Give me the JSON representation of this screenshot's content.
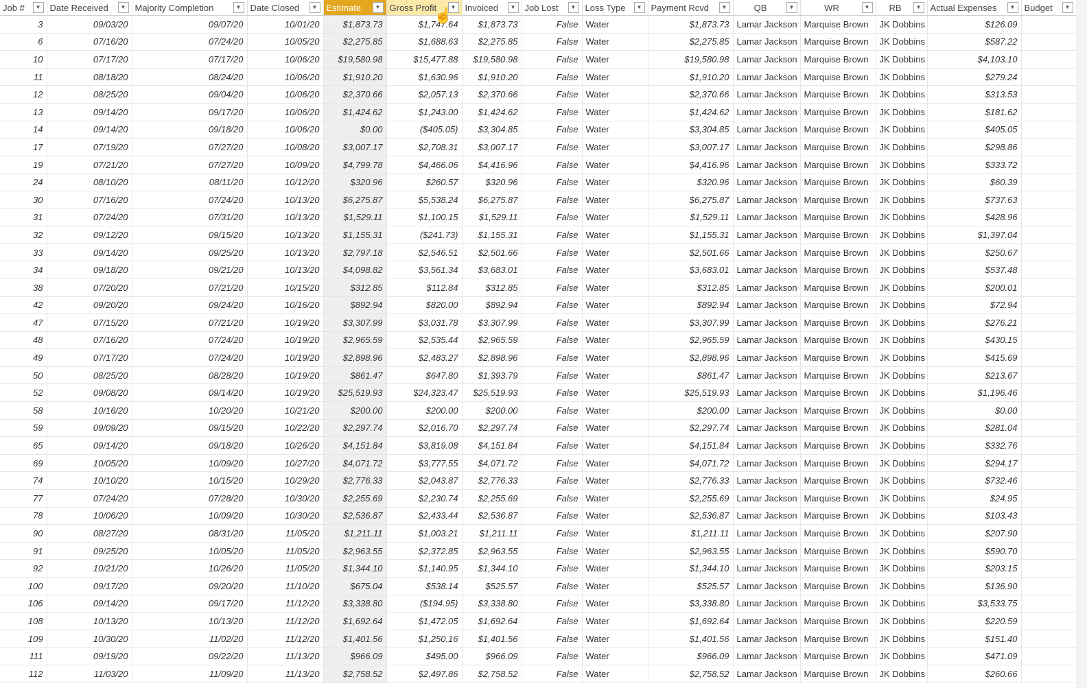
{
  "columns": [
    "Job #",
    "Date Received",
    "Majority Completion",
    "Date Closed",
    "Estimate",
    "Gross Profit",
    "Invoiced",
    "Job Lost",
    "Loss Type",
    "Payment Rcvd",
    "QB",
    "WR",
    "RB",
    "Actual Expenses",
    "Budget"
  ],
  "selected_column": "Estimate",
  "hovered_column": "Gross Profit",
  "colors": {
    "selected_header": "#e3a61f",
    "hover_header": "#fbe9a9",
    "selected_column_bg": "#efefef"
  },
  "rows": [
    [
      "3",
      "09/03/20",
      "09/07/20",
      "10/01/20",
      "$1,873.73",
      "$1,747.64",
      "$1,873.73",
      "False",
      "Water",
      "$1,873.73",
      "Lamar Jackson",
      "Marquise Brown",
      "JK Dobbins",
      "$126.09",
      ""
    ],
    [
      "6",
      "07/16/20",
      "07/24/20",
      "10/05/20",
      "$2,275.85",
      "$1,688.63",
      "$2,275.85",
      "False",
      "Water",
      "$2,275.85",
      "Lamar Jackson",
      "Marquise Brown",
      "JK Dobbins",
      "$587.22",
      ""
    ],
    [
      "10",
      "07/17/20",
      "07/17/20",
      "10/06/20",
      "$19,580.98",
      "$15,477.88",
      "$19,580.98",
      "False",
      "Water",
      "$19,580.98",
      "Lamar Jackson",
      "Marquise Brown",
      "JK Dobbins",
      "$4,103.10",
      ""
    ],
    [
      "11",
      "08/18/20",
      "08/24/20",
      "10/06/20",
      "$1,910.20",
      "$1,630.96",
      "$1,910.20",
      "False",
      "Water",
      "$1,910.20",
      "Lamar Jackson",
      "Marquise Brown",
      "JK Dobbins",
      "$279.24",
      ""
    ],
    [
      "12",
      "08/25/20",
      "09/04/20",
      "10/06/20",
      "$2,370.66",
      "$2,057.13",
      "$2,370.66",
      "False",
      "Water",
      "$2,370.66",
      "Lamar Jackson",
      "Marquise Brown",
      "JK Dobbins",
      "$313.53",
      ""
    ],
    [
      "13",
      "09/14/20",
      "09/17/20",
      "10/06/20",
      "$1,424.62",
      "$1,243.00",
      "$1,424.62",
      "False",
      "Water",
      "$1,424.62",
      "Lamar Jackson",
      "Marquise Brown",
      "JK Dobbins",
      "$181.62",
      ""
    ],
    [
      "14",
      "09/14/20",
      "09/18/20",
      "10/06/20",
      "$0.00",
      "($405.05)",
      "$3,304.85",
      "False",
      "Water",
      "$3,304.85",
      "Lamar Jackson",
      "Marquise Brown",
      "JK Dobbins",
      "$405.05",
      ""
    ],
    [
      "17",
      "07/19/20",
      "07/27/20",
      "10/08/20",
      "$3,007.17",
      "$2,708.31",
      "$3,007.17",
      "False",
      "Water",
      "$3,007.17",
      "Lamar Jackson",
      "Marquise Brown",
      "JK Dobbins",
      "$298.86",
      ""
    ],
    [
      "19",
      "07/21/20",
      "07/27/20",
      "10/09/20",
      "$4,799.78",
      "$4,466.06",
      "$4,416.96",
      "False",
      "Water",
      "$4,416.96",
      "Lamar Jackson",
      "Marquise Brown",
      "JK Dobbins",
      "$333.72",
      ""
    ],
    [
      "24",
      "08/10/20",
      "08/11/20",
      "10/12/20",
      "$320.96",
      "$260.57",
      "$320.96",
      "False",
      "Water",
      "$320.96",
      "Lamar Jackson",
      "Marquise Brown",
      "JK Dobbins",
      "$60.39",
      ""
    ],
    [
      "30",
      "07/16/20",
      "07/24/20",
      "10/13/20",
      "$6,275.87",
      "$5,538.24",
      "$6,275.87",
      "False",
      "Water",
      "$6,275.87",
      "Lamar Jackson",
      "Marquise Brown",
      "JK Dobbins",
      "$737.63",
      ""
    ],
    [
      "31",
      "07/24/20",
      "07/31/20",
      "10/13/20",
      "$1,529.11",
      "$1,100.15",
      "$1,529.11",
      "False",
      "Water",
      "$1,529.11",
      "Lamar Jackson",
      "Marquise Brown",
      "JK Dobbins",
      "$428.96",
      ""
    ],
    [
      "32",
      "09/12/20",
      "09/15/20",
      "10/13/20",
      "$1,155.31",
      "($241.73)",
      "$1,155.31",
      "False",
      "Water",
      "$1,155.31",
      "Lamar Jackson",
      "Marquise Brown",
      "JK Dobbins",
      "$1,397.04",
      ""
    ],
    [
      "33",
      "09/14/20",
      "09/25/20",
      "10/13/20",
      "$2,797.18",
      "$2,546.51",
      "$2,501.66",
      "False",
      "Water",
      "$2,501.66",
      "Lamar Jackson",
      "Marquise Brown",
      "JK Dobbins",
      "$250.67",
      ""
    ],
    [
      "34",
      "09/18/20",
      "09/21/20",
      "10/13/20",
      "$4,098.82",
      "$3,561.34",
      "$3,683.01",
      "False",
      "Water",
      "$3,683.01",
      "Lamar Jackson",
      "Marquise Brown",
      "JK Dobbins",
      "$537.48",
      ""
    ],
    [
      "38",
      "07/20/20",
      "07/21/20",
      "10/15/20",
      "$312.85",
      "$112.84",
      "$312.85",
      "False",
      "Water",
      "$312.85",
      "Lamar Jackson",
      "Marquise Brown",
      "JK Dobbins",
      "$200.01",
      ""
    ],
    [
      "42",
      "09/20/20",
      "09/24/20",
      "10/16/20",
      "$892.94",
      "$820.00",
      "$892.94",
      "False",
      "Water",
      "$892.94",
      "Lamar Jackson",
      "Marquise Brown",
      "JK Dobbins",
      "$72.94",
      ""
    ],
    [
      "47",
      "07/15/20",
      "07/21/20",
      "10/19/20",
      "$3,307.99",
      "$3,031.78",
      "$3,307.99",
      "False",
      "Water",
      "$3,307.99",
      "Lamar Jackson",
      "Marquise Brown",
      "JK Dobbins",
      "$276.21",
      ""
    ],
    [
      "48",
      "07/16/20",
      "07/24/20",
      "10/19/20",
      "$2,965.59",
      "$2,535.44",
      "$2,965.59",
      "False",
      "Water",
      "$2,965.59",
      "Lamar Jackson",
      "Marquise Brown",
      "JK Dobbins",
      "$430.15",
      ""
    ],
    [
      "49",
      "07/17/20",
      "07/24/20",
      "10/19/20",
      "$2,898.96",
      "$2,483.27",
      "$2,898.96",
      "False",
      "Water",
      "$2,898.96",
      "Lamar Jackson",
      "Marquise Brown",
      "JK Dobbins",
      "$415.69",
      ""
    ],
    [
      "50",
      "08/25/20",
      "08/28/20",
      "10/19/20",
      "$861.47",
      "$647.80",
      "$1,393.79",
      "False",
      "Water",
      "$861.47",
      "Lamar Jackson",
      "Marquise Brown",
      "JK Dobbins",
      "$213.67",
      ""
    ],
    [
      "52",
      "09/08/20",
      "09/14/20",
      "10/19/20",
      "$25,519.93",
      "$24,323.47",
      "$25,519.93",
      "False",
      "Water",
      "$25,519.93",
      "Lamar Jackson",
      "Marquise Brown",
      "JK Dobbins",
      "$1,196.46",
      ""
    ],
    [
      "58",
      "10/16/20",
      "10/20/20",
      "10/21/20",
      "$200.00",
      "$200.00",
      "$200.00",
      "False",
      "Water",
      "$200.00",
      "Lamar Jackson",
      "Marquise Brown",
      "JK Dobbins",
      "$0.00",
      ""
    ],
    [
      "59",
      "09/09/20",
      "09/15/20",
      "10/22/20",
      "$2,297.74",
      "$2,016.70",
      "$2,297.74",
      "False",
      "Water",
      "$2,297.74",
      "Lamar Jackson",
      "Marquise Brown",
      "JK Dobbins",
      "$281.04",
      ""
    ],
    [
      "65",
      "09/14/20",
      "09/18/20",
      "10/26/20",
      "$4,151.84",
      "$3,819.08",
      "$4,151.84",
      "False",
      "Water",
      "$4,151.84",
      "Lamar Jackson",
      "Marquise Brown",
      "JK Dobbins",
      "$332.76",
      ""
    ],
    [
      "69",
      "10/05/20",
      "10/09/20",
      "10/27/20",
      "$4,071.72",
      "$3,777.55",
      "$4,071.72",
      "False",
      "Water",
      "$4,071.72",
      "Lamar Jackson",
      "Marquise Brown",
      "JK Dobbins",
      "$294.17",
      ""
    ],
    [
      "74",
      "10/10/20",
      "10/15/20",
      "10/29/20",
      "$2,776.33",
      "$2,043.87",
      "$2,776.33",
      "False",
      "Water",
      "$2,776.33",
      "Lamar Jackson",
      "Marquise Brown",
      "JK Dobbins",
      "$732.46",
      ""
    ],
    [
      "77",
      "07/24/20",
      "07/28/20",
      "10/30/20",
      "$2,255.69",
      "$2,230.74",
      "$2,255.69",
      "False",
      "Water",
      "$2,255.69",
      "Lamar Jackson",
      "Marquise Brown",
      "JK Dobbins",
      "$24.95",
      ""
    ],
    [
      "78",
      "10/06/20",
      "10/09/20",
      "10/30/20",
      "$2,536.87",
      "$2,433.44",
      "$2,536.87",
      "False",
      "Water",
      "$2,536.87",
      "Lamar Jackson",
      "Marquise Brown",
      "JK Dobbins",
      "$103.43",
      ""
    ],
    [
      "90",
      "08/27/20",
      "08/31/20",
      "11/05/20",
      "$1,211.11",
      "$1,003.21",
      "$1,211.11",
      "False",
      "Water",
      "$1,211.11",
      "Lamar Jackson",
      "Marquise Brown",
      "JK Dobbins",
      "$207.90",
      ""
    ],
    [
      "91",
      "09/25/20",
      "10/05/20",
      "11/05/20",
      "$2,963.55",
      "$2,372.85",
      "$2,963.55",
      "False",
      "Water",
      "$2,963.55",
      "Lamar Jackson",
      "Marquise Brown",
      "JK Dobbins",
      "$590.70",
      ""
    ],
    [
      "92",
      "10/21/20",
      "10/26/20",
      "11/05/20",
      "$1,344.10",
      "$1,140.95",
      "$1,344.10",
      "False",
      "Water",
      "$1,344.10",
      "Lamar Jackson",
      "Marquise Brown",
      "JK Dobbins",
      "$203.15",
      ""
    ],
    [
      "100",
      "09/17/20",
      "09/20/20",
      "11/10/20",
      "$675.04",
      "$538.14",
      "$525.57",
      "False",
      "Water",
      "$525.57",
      "Lamar Jackson",
      "Marquise Brown",
      "JK Dobbins",
      "$136.90",
      ""
    ],
    [
      "106",
      "09/14/20",
      "09/17/20",
      "11/12/20",
      "$3,338.80",
      "($194.95)",
      "$3,338.80",
      "False",
      "Water",
      "$3,338.80",
      "Lamar Jackson",
      "Marquise Brown",
      "JK Dobbins",
      "$3,533.75",
      ""
    ],
    [
      "108",
      "10/13/20",
      "10/13/20",
      "11/12/20",
      "$1,692.64",
      "$1,472.05",
      "$1,692.64",
      "False",
      "Water",
      "$1,692.64",
      "Lamar Jackson",
      "Marquise Brown",
      "JK Dobbins",
      "$220.59",
      ""
    ],
    [
      "109",
      "10/30/20",
      "11/02/20",
      "11/12/20",
      "$1,401.56",
      "$1,250.16",
      "$1,401.56",
      "False",
      "Water",
      "$1,401.56",
      "Lamar Jackson",
      "Marquise Brown",
      "JK Dobbins",
      "$151.40",
      ""
    ],
    [
      "111",
      "09/19/20",
      "09/22/20",
      "11/13/20",
      "$966.09",
      "$495.00",
      "$966.09",
      "False",
      "Water",
      "$966.09",
      "Lamar Jackson",
      "Marquise Brown",
      "JK Dobbins",
      "$471.09",
      ""
    ],
    [
      "112",
      "11/03/20",
      "11/09/20",
      "11/13/20",
      "$2,758.52",
      "$2,497.86",
      "$2,758.52",
      "False",
      "Water",
      "$2,758.52",
      "Lamar Jackson",
      "Marquise Brown",
      "JK Dobbins",
      "$260.66",
      ""
    ]
  ]
}
